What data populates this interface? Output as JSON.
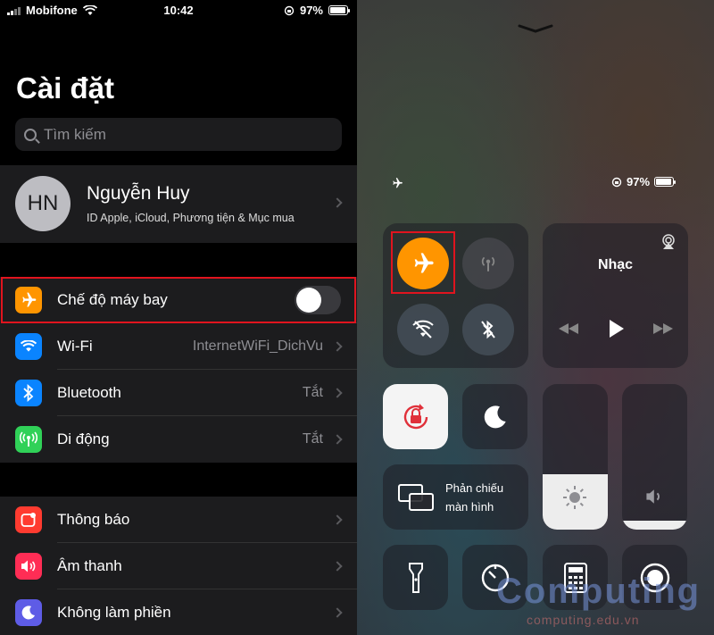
{
  "status_bar": {
    "carrier": "Mobifone",
    "time": "10:42",
    "battery": "97%"
  },
  "settings": {
    "title": "Cài đặt",
    "search_placeholder": "Tìm kiếm",
    "profile": {
      "initials": "HN",
      "name": "Nguyễn Huy",
      "subtitle": "ID Apple, iCloud, Phương tiện & Mục mua"
    },
    "group1": [
      {
        "label": "Chế độ máy bay",
        "icon": "airplane-icon",
        "color": "#ff9500",
        "toggle": false
      },
      {
        "label": "Wi-Fi",
        "value": "InternetWiFi_DichVu",
        "icon": "wifi-icon",
        "color": "#0a84ff"
      },
      {
        "label": "Bluetooth",
        "value": "Tắt",
        "icon": "bluetooth-icon",
        "color": "#0a84ff"
      },
      {
        "label": "Di động",
        "value": "Tắt",
        "icon": "cellular-icon",
        "color": "#30d158"
      }
    ],
    "group2": [
      {
        "label": "Thông báo",
        "icon": "notifications-icon",
        "color": "#ff3b30"
      },
      {
        "label": "Âm thanh",
        "icon": "sounds-icon",
        "color": "#ff2d55"
      },
      {
        "label": "Không làm phiền",
        "icon": "moon-icon",
        "color": "#5e5ce6"
      }
    ]
  },
  "control_center": {
    "battery": "97%",
    "music_title": "Nhạc",
    "screen_mirroring_line1": "Phản chiếu",
    "screen_mirroring_line2": "màn hình",
    "airplane_on": true,
    "brightness_level": 0.38,
    "volume_level": 0.06
  },
  "watermark": {
    "main": "Computing",
    "sub": "computing.edu.vn"
  },
  "colors": {
    "accent_orange": "#ff9500",
    "highlight_red": "#e0141e"
  }
}
